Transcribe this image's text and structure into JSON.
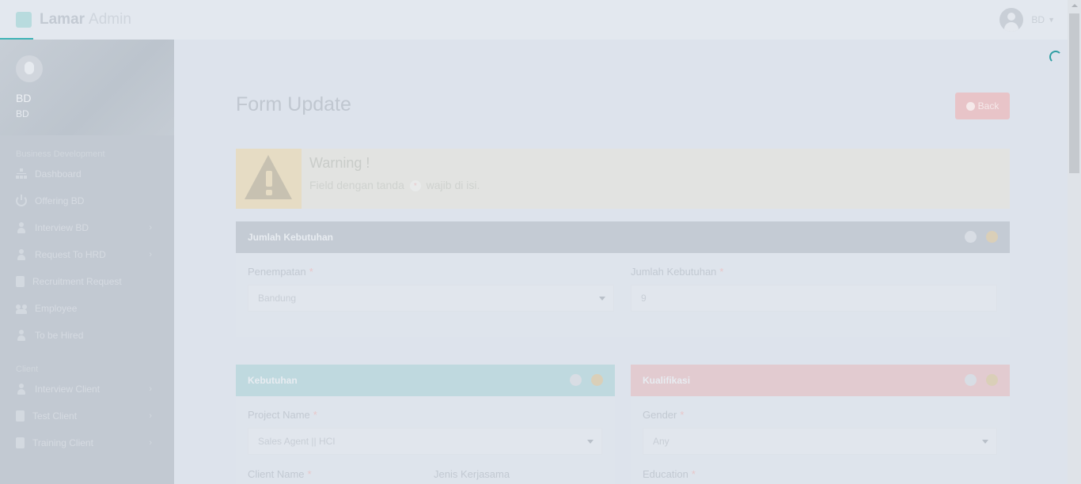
{
  "header": {
    "brand_bold": "Lamar",
    "brand_light": "Admin",
    "user_label": "BD"
  },
  "sidebar": {
    "profile_name": "BD",
    "profile_role": "BD",
    "sections": [
      {
        "title": "Business Development",
        "items": [
          {
            "label": "Dashboard",
            "icon": "sitemap-icon",
            "has_submenu": false
          },
          {
            "label": "Offering BD",
            "icon": "power-icon",
            "has_submenu": false
          },
          {
            "label": "Interview BD",
            "icon": "user-icon",
            "has_submenu": true
          },
          {
            "label": "Request To HRD",
            "icon": "user-icon",
            "has_submenu": true
          },
          {
            "label": "Recruitment Request",
            "icon": "clipboard-icon",
            "has_submenu": false
          },
          {
            "label": "Employee",
            "icon": "users-icon",
            "has_submenu": false
          },
          {
            "label": "To be Hired",
            "icon": "user-icon",
            "has_submenu": false
          }
        ]
      },
      {
        "title": "Client",
        "items": [
          {
            "label": "Interview Client",
            "icon": "user-icon",
            "has_submenu": true
          },
          {
            "label": "Test Client",
            "icon": "clipboard-icon",
            "has_submenu": true
          },
          {
            "label": "Training Client",
            "icon": "clipboard-icon",
            "has_submenu": true
          }
        ]
      }
    ],
    "chevron": "›"
  },
  "main": {
    "title": "Form Update",
    "back_label": "Back",
    "warning": {
      "title": "Warning !",
      "message_before": "Field dengan tanda",
      "star": "*",
      "message_after": "wajib di isi."
    },
    "panels": {
      "jumlah": {
        "title": "Jumlah Kebutuhan",
        "penempatan_label": "Penempatan",
        "penempatan_value": "Bandung",
        "jumlah_label": "Jumlah Kebutuhan",
        "jumlah_value": "9"
      },
      "kebutuhan": {
        "title": "Kebutuhan",
        "project_label": "Project Name",
        "project_value": "Sales Agent || HCI",
        "client_label": "Client Name",
        "jenis_label": "Jenis Kerjasama"
      },
      "kualifikasi": {
        "title": "Kualifikasi",
        "gender_label": "Gender",
        "gender_value": "Any",
        "education_label": "Education"
      }
    },
    "required_mark": "*"
  },
  "colors": {
    "accent": "#3fb3b6",
    "jumlah_head": "#c4cbd4",
    "kebutuhan_head": "#bfd9df",
    "kualifikasi_head": "#e2cbd0",
    "back_button": "#e8c4c8"
  }
}
